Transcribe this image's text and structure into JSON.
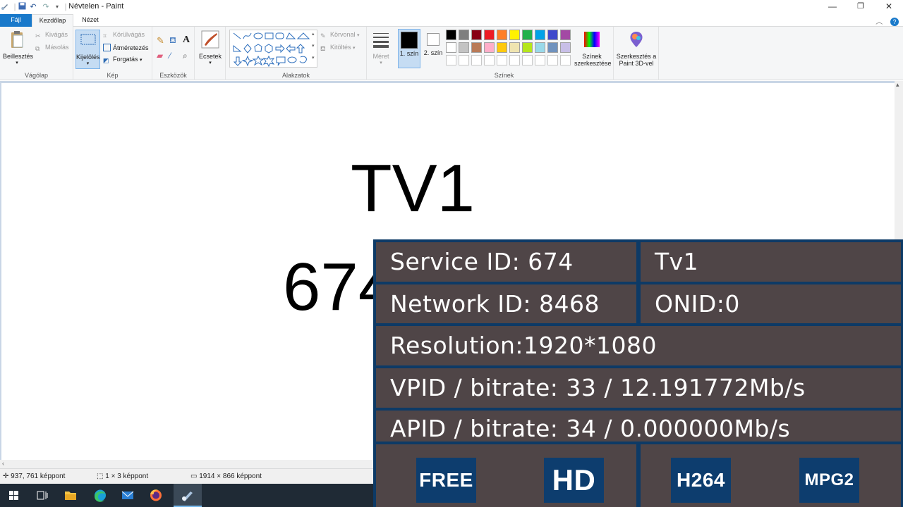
{
  "window": {
    "title": "Névtelen - Paint",
    "minimize_glyph": "—",
    "maximize_glyph": "❐",
    "close_glyph": "✕"
  },
  "tabs": {
    "file": "Fájl",
    "home": "Kezdőlap",
    "view": "Nézet"
  },
  "ribbon": {
    "clipboard": {
      "label": "Vágólap",
      "paste": "Beillesztés",
      "cut": "Kivágás",
      "copy": "Másolás"
    },
    "image": {
      "label": "Kép",
      "select": "Kijelölés",
      "crop": "Körülvágás",
      "resize": "Átméretezés",
      "rotate": "Forgatás"
    },
    "tools": {
      "label": "Eszközök"
    },
    "brushes": {
      "label": "Ecsetek"
    },
    "shapes": {
      "label": "Alakzatok",
      "outline": "Körvonal",
      "fill": "Kitöltés"
    },
    "size": {
      "label": "Méret"
    },
    "colors": {
      "label": "Színek",
      "color1": "1. szín",
      "color2": "2. szín",
      "edit_colors": "Színek szerkesztése",
      "paint3d": "Szerkesztés a Paint 3D-vel",
      "color1_value": "#000000",
      "color2_value": "#ffffff",
      "palette_row1": [
        "#000000",
        "#7f7f7f",
        "#880015",
        "#ed1c24",
        "#ff7f27",
        "#fff200",
        "#22b14c",
        "#00a2e8",
        "#3f48cc",
        "#a349a4"
      ],
      "palette_row2": [
        "#ffffff",
        "#c3c3c3",
        "#b97a57",
        "#ffaec9",
        "#ffc90e",
        "#efe4b0",
        "#b5e61d",
        "#99d9ea",
        "#7092be",
        "#c8bfe7"
      ],
      "palette_row3": [
        "#ffffff",
        "#ffffff",
        "#ffffff",
        "#ffffff",
        "#ffffff",
        "#ffffff",
        "#ffffff",
        "#ffffff",
        "#ffffff",
        "#ffffff"
      ]
    }
  },
  "canvas": {
    "big_text": "TV1",
    "number_text": "674"
  },
  "status": {
    "cursor_pos": "937, 761 képpont",
    "selection_size": "1 × 3 képpont",
    "image_size": "1914 × 866 képpont"
  },
  "overlay": {
    "service_id": "Service ID: 674",
    "channel_name": "Tv1",
    "network_id": "Network ID: 8468",
    "onid": "ONID:0",
    "resolution": "Resolution:1920*1080",
    "vpid": "VPID / bitrate: 33 / 12.191772Mb/s",
    "apid": "APID / bitrate: 34 / 0.000000Mb/s",
    "badges": [
      "FREE",
      "HD",
      "H264",
      "MPG2"
    ],
    "colors": {
      "frame": "#0d3a66",
      "cell": "#4f4547",
      "badge": "#0d3d6e"
    }
  },
  "taskbar": {
    "icons": [
      "windows-start-icon",
      "task-view-icon",
      "file-explorer-icon",
      "edge-icon",
      "mail-icon",
      "firefox-icon",
      "paint-icon"
    ]
  }
}
